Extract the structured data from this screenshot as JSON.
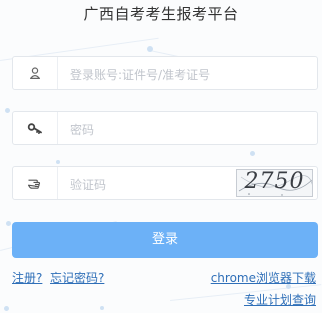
{
  "page": {
    "title": "广西自考考生报考平台"
  },
  "form": {
    "account_placeholder": "登录账号:证件号/准考证号",
    "password_placeholder": "密码",
    "captcha_placeholder": "验证码",
    "captcha_text": "2750",
    "login_label": "登录"
  },
  "links": {
    "register": "注册?",
    "forgot": "忘记密码?",
    "chrome_download": "chrome浏览器下载",
    "major_plan": "专业计划查询"
  },
  "icons": {
    "account": "user-icon",
    "password": "key-icon",
    "captcha": "hand-pointer-icon"
  },
  "colors": {
    "primary_button": "#6cb1f7",
    "link": "#2f6fb8",
    "placeholder": "#c1c5cc",
    "title": "#333333"
  }
}
